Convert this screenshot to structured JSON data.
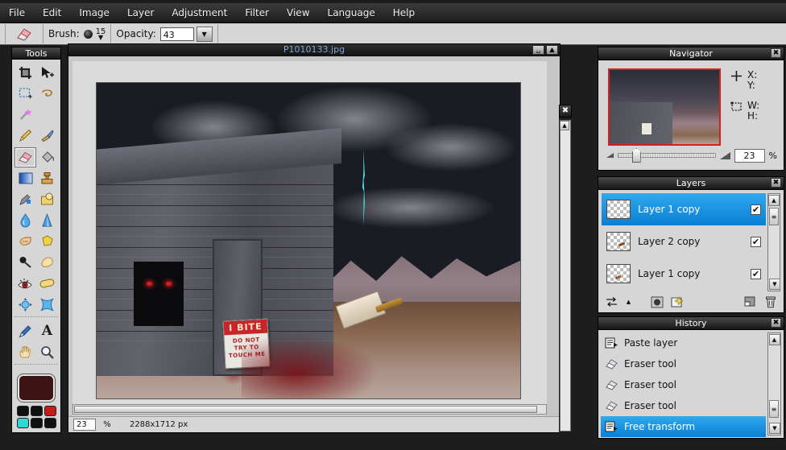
{
  "menubar": {
    "items": [
      {
        "label": "File"
      },
      {
        "label": "Edit"
      },
      {
        "label": "Image"
      },
      {
        "label": "Layer"
      },
      {
        "label": "Adjustment"
      },
      {
        "label": "Filter"
      },
      {
        "label": "View"
      },
      {
        "label": "Language"
      },
      {
        "label": "Help"
      }
    ]
  },
  "options_bar": {
    "active_tool_icon": "eraser-icon",
    "brush_label": "Brush:",
    "brush_size": "15",
    "opacity_label": "Opacity:",
    "opacity_value": "43"
  },
  "tools_panel": {
    "title": "Tools",
    "close_icon": "✖",
    "selected_tool": "eraser",
    "items": [
      {
        "name": "crop-tool",
        "icon": "⬚"
      },
      {
        "name": "move-tool",
        "icon": "➤"
      },
      {
        "name": "rectangle-select-tool",
        "icon": "⬚"
      },
      {
        "name": "lasso-select-tool",
        "icon": "◌"
      },
      {
        "name": "magic-wand-tool",
        "icon": "✨"
      },
      {
        "name": "pencil-tool",
        "icon": "✎"
      },
      {
        "name": "brush-tool",
        "icon": "🖌"
      },
      {
        "name": "eraser-tool",
        "icon": "▭"
      },
      {
        "name": "paint-bucket-tool",
        "icon": "▲"
      },
      {
        "name": "gradient-tool",
        "icon": "■"
      },
      {
        "name": "clone-stamp-tool",
        "icon": "⬛"
      },
      {
        "name": "smudge-tool",
        "icon": "✏"
      },
      {
        "name": "shape-tool",
        "icon": "□"
      },
      {
        "name": "blur-tool",
        "icon": "💧"
      },
      {
        "name": "sharpen-tool",
        "icon": "▲"
      },
      {
        "name": "dodge-tool",
        "icon": "☝"
      },
      {
        "name": "sponge-tool",
        "icon": "◆"
      },
      {
        "name": "burn-tool",
        "icon": "⚫"
      },
      {
        "name": "blend-tool",
        "icon": "✋"
      },
      {
        "name": "red-eye-tool",
        "icon": "👁"
      },
      {
        "name": "pill-tool",
        "icon": "◯"
      },
      {
        "name": "warp-tool",
        "icon": "✤"
      },
      {
        "name": "pinch-tool",
        "icon": "✦"
      },
      {
        "name": "eyedropper-tool",
        "icon": "✒"
      },
      {
        "name": "text-tool",
        "icon": "A"
      },
      {
        "name": "hand-tool",
        "icon": "✋"
      },
      {
        "name": "zoom-tool",
        "icon": "🔍"
      }
    ],
    "primary_color": "#3d1414",
    "swatches": [
      "#101010",
      "#101010",
      "#c81a1a",
      "#2fd6d6",
      "#101010",
      "#101010"
    ]
  },
  "document": {
    "title": "P1010133.jpg",
    "minimize_icon": "␣",
    "maximize_icon": "▲",
    "status_zoom": "23",
    "status_percent": "%",
    "status_dimensions": "2288x1712 px",
    "canvas": {
      "sign_header": "I BITE",
      "sign_line1": "DO NOT",
      "sign_line2": "TRY TO",
      "sign_line3": "TOUCH ME"
    },
    "scrollbar_close_icon": "✖"
  },
  "navigator": {
    "title": "Navigator",
    "close_icon": "✖",
    "position_icon": "crosshair-icon",
    "size_icon": "bounding-box-icon",
    "x_label": "X:",
    "y_label": "Y:",
    "w_label": "W:",
    "h_label": "H:",
    "zoom_value": "23",
    "percent_label": "%",
    "zoom_out_icon": "small-triangle-icon",
    "zoom_in_icon": "large-triangle-icon"
  },
  "layers": {
    "title": "Layers",
    "close_icon": "✖",
    "items": [
      {
        "name": "Layer 1 copy",
        "visible": "✔",
        "selected": true
      },
      {
        "name": "Layer 2 copy",
        "visible": "✔",
        "selected": false
      },
      {
        "name": "Layer 1 copy",
        "visible": "✔",
        "selected": false
      }
    ],
    "scroll_up_icon": "▲",
    "scroll_down_icon": "▼",
    "toolbar": [
      {
        "name": "blend-mode-button",
        "icon": "⇅"
      },
      {
        "name": "blend-mode-arrow",
        "icon": "▲"
      },
      {
        "name": "layer-mask-button",
        "icon": "◉"
      },
      {
        "name": "new-layer-button",
        "icon": "❐"
      },
      {
        "name": "duplicate-layer-button",
        "icon": "◨"
      },
      {
        "name": "delete-layer-button",
        "icon": "🗑"
      }
    ]
  },
  "history": {
    "title": "History",
    "close_icon": "✖",
    "items": [
      {
        "label": "Paste layer",
        "icon": "document-icon",
        "selected": false
      },
      {
        "label": "Eraser tool",
        "icon": "eraser-icon",
        "selected": false
      },
      {
        "label": "Eraser tool",
        "icon": "eraser-icon",
        "selected": false
      },
      {
        "label": "Eraser tool",
        "icon": "eraser-icon",
        "selected": false
      },
      {
        "label": "Free transform",
        "icon": "document-icon",
        "selected": true
      }
    ],
    "scroll_up_icon": "▲",
    "scroll_down_icon": "▼"
  }
}
